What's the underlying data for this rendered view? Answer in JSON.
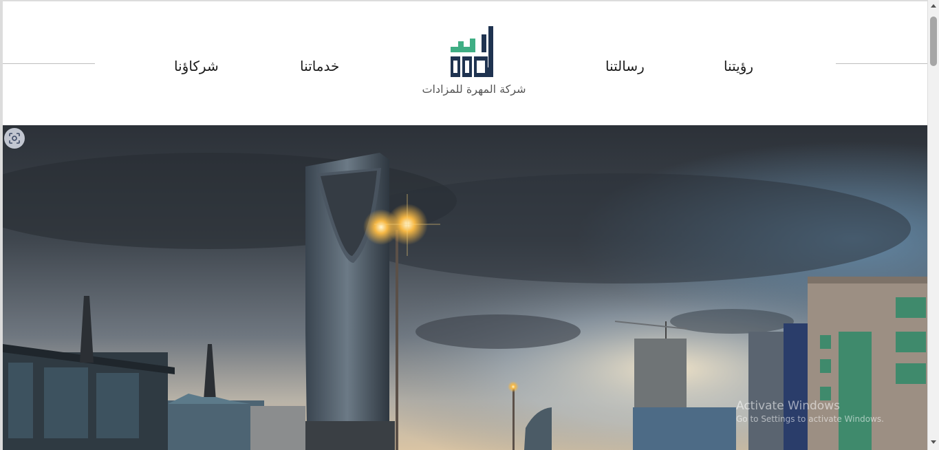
{
  "nav": {
    "items": [
      {
        "label": "رؤيتنا"
      },
      {
        "label": "رسالتنا"
      },
      {
        "label": "خدماتنا"
      },
      {
        "label": "شركاؤنا"
      }
    ]
  },
  "logo": {
    "company_name": "شركة المهرة للمزادات",
    "colors": {
      "dark": "#1f3350",
      "accent": "#3fae84"
    }
  },
  "hero": {
    "description_icon": "google-lens-icon"
  },
  "os_watermark": {
    "title": "Activate Windows",
    "subtitle": "Go to Settings to activate Windows."
  },
  "colors": {
    "header_bg": "#ffffff",
    "rule": "#bdbdbd",
    "nav_text": "#1a1a1a"
  }
}
